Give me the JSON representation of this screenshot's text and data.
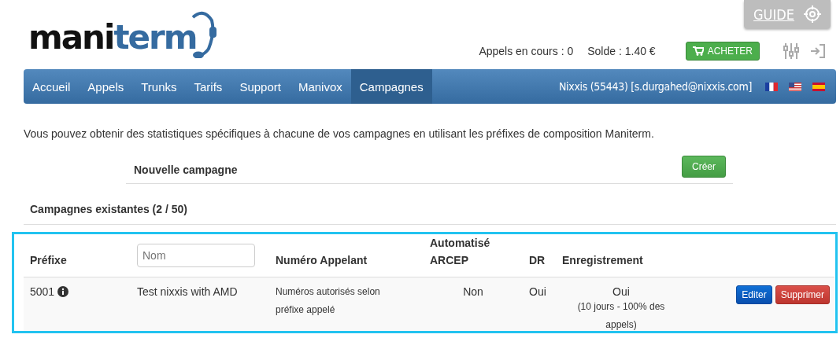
{
  "logo": {
    "dark": "mani",
    "accent": "term"
  },
  "guide": {
    "label": "GUIDE"
  },
  "status": {
    "calls": "Appels en cours : 0",
    "balance": "Solde : 1.40 €",
    "buy": "ACHETER"
  },
  "nav": {
    "items": [
      {
        "label": "Accueil",
        "selected": false
      },
      {
        "label": "Appels",
        "selected": false
      },
      {
        "label": "Trunks",
        "selected": false
      },
      {
        "label": "Tarifs",
        "selected": false
      },
      {
        "label": "Support",
        "selected": false
      },
      {
        "label": "Manivox",
        "selected": false
      },
      {
        "label": "Campagnes",
        "selected": true
      }
    ],
    "account": "Nixxis (55443) [s.durgahed@nixxis.com]",
    "flags": [
      {
        "kind": "fr"
      },
      {
        "kind": "us"
      },
      {
        "kind": "es"
      }
    ]
  },
  "intro": "Vous pouvez obtenir des statistiques spécifiques à chacune de vos campagnes en utilisant les préfixes de composition Maniterm.",
  "new_campaign": {
    "label": "Nouvelle campagne",
    "button": "Créer"
  },
  "existing_title": "Campagnes existantes (2 / 50)",
  "table": {
    "columns": [
      {
        "kind": "text",
        "label": "Préfixe"
      },
      {
        "kind": "filter",
        "placeholder": "Nom"
      },
      {
        "kind": "text",
        "label": "Numéro Appelant"
      },
      {
        "kind": "text",
        "label": "Automatisé ARCEP"
      },
      {
        "kind": "text",
        "label": "DR"
      },
      {
        "kind": "text",
        "label": "Enregistrement"
      }
    ],
    "rows": [
      {
        "prefix": "5001",
        "name": "Test nixxis with AMD",
        "caller": "Numéros autorisés selon préfixe appelé",
        "arcep": "Non",
        "dr": "Oui",
        "recording": "Oui",
        "recording_detail": "(10 jours - 100% des appels)",
        "edit": "Editer",
        "delete": "Supprimer"
      }
    ]
  }
}
